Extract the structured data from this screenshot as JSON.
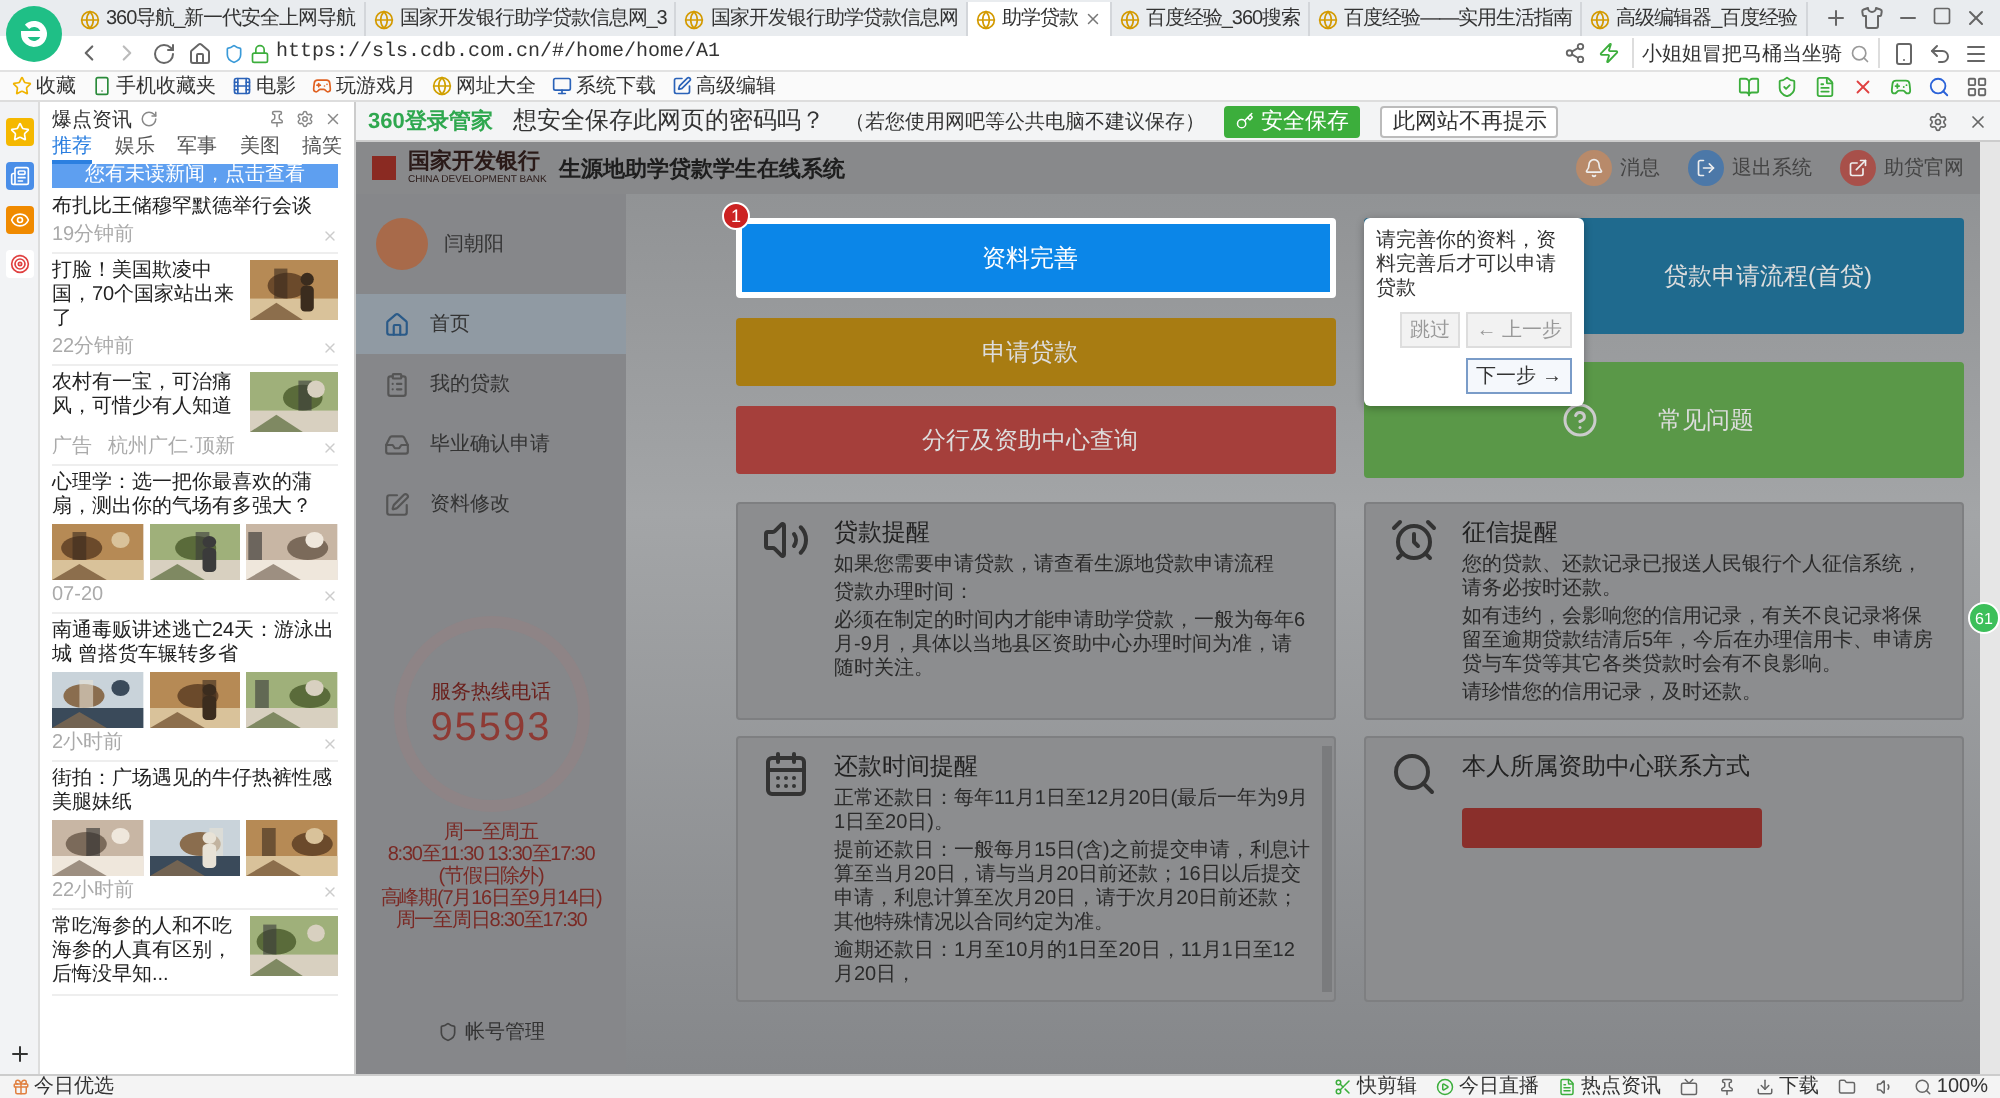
{
  "browser": {
    "tabs": [
      {
        "title": "360导航_新一代安全上网导航",
        "selected": false
      },
      {
        "title": "国家开发银行助学贷款信息网_3",
        "selected": false
      },
      {
        "title": "国家开发银行助学贷款信息网",
        "selected": false
      },
      {
        "title": "助学贷款",
        "selected": true
      },
      {
        "title": "百度经验_360搜索",
        "selected": false
      },
      {
        "title": "百度经验——实用生活指南",
        "selected": false
      },
      {
        "title": "高级编辑器_百度经验",
        "selected": false
      }
    ],
    "url": "https://sls.cdb.com.cn/#/home/home/A1",
    "search_value": "小姐姐冒把马桶当坐骑",
    "bookmarks": [
      "收藏",
      "手机收藏夹",
      "电影",
      "玩游戏月",
      "网址大全",
      "系统下载",
      "高级编辑"
    ]
  },
  "news_panel": {
    "title": "爆点资讯",
    "tabs": [
      {
        "label": "推荐",
        "selected": true
      },
      {
        "label": "娱乐",
        "selected": false
      },
      {
        "label": "军事",
        "selected": false
      },
      {
        "label": "美图",
        "selected": false
      },
      {
        "label": "搞笑",
        "selected": false
      }
    ],
    "banner": "您有未读新闻，点击查看",
    "items": [
      {
        "kind": "text",
        "title": "布扎比王储穆罕默德举行会谈",
        "meta": [
          "19分钟前"
        ]
      },
      {
        "kind": "right-image",
        "title": "打脸！美国欺凌中国，70个国家站出来了",
        "meta": [
          "22分钟前"
        ]
      },
      {
        "kind": "right-image",
        "title": "农村有一宝，可治痛风，可惜少有人知道",
        "meta": [
          "广告",
          "杭州广仁·顶新"
        ]
      },
      {
        "kind": "three-images",
        "title": "心理学：选一把你最喜欢的蒲扇，测出你的气场有多强大？",
        "meta": [
          "07-20"
        ]
      },
      {
        "kind": "three-images",
        "title": "南通毒贩讲述逃亡24天：游泳出城 曾搭货车辗转多省",
        "meta": [
          "2小时前"
        ]
      },
      {
        "kind": "three-images",
        "title": "街拍：广场遇见的牛仔热裤性感美腿妹纸",
        "meta": [
          "22小时前"
        ]
      },
      {
        "kind": "right-image",
        "title": "常吃海参的人和不吃海参的人真有区别，后悔没早知..."
      }
    ]
  },
  "password_prompt": {
    "brand": "360登录管家",
    "question": "想安全保存此网页的密码吗？",
    "note": "（若您使用网吧等公共电脑不建议保存）",
    "buttons": [
      {
        "label": "安全保存",
        "kind": "primary"
      },
      {
        "label": "此网站不再提示",
        "kind": "plain"
      }
    ]
  },
  "page": {
    "bank_name": "国家开发银行",
    "bank_name_en": "CHINA DEVELOPMENT BANK",
    "system_title": "生源地助学贷款学生在线系统",
    "header_links": [
      "消息",
      "退出系统",
      "助贷官网"
    ],
    "user_name": "闫朝阳",
    "nav": [
      {
        "label": "首页",
        "selected": true
      },
      {
        "label": "我的贷款",
        "selected": false
      },
      {
        "label": "毕业确认申请",
        "selected": false
      },
      {
        "label": "资料修改",
        "selected": false
      }
    ],
    "hotline": {
      "label": "服务热线电话",
      "number": "95593",
      "hours": [
        "周一至周五",
        "8:30至11:30 13:30至17:30",
        "(节假日除外)",
        "高峰期(7月16日至9月14日)",
        "周一至周日8:30至17:30"
      ]
    },
    "account_link": "帐号管理",
    "left_tiles": [
      {
        "label": "资料完善",
        "color": "#0b86e8",
        "highlighted": true
      },
      {
        "label": "申请贷款",
        "color": "#a87c12",
        "highlighted": false
      },
      {
        "label": "分行及资助中心查询",
        "color": "#a53f3b",
        "highlighted": false
      }
    ],
    "right_tiles": [
      {
        "label": "贷款申请流程(首贷)",
        "color": "#1f6a8e",
        "highlighted": false
      },
      {
        "label": "常见问题",
        "color": "#5a9848",
        "highlighted": false
      }
    ],
    "guide": {
      "step": "1",
      "text": "请完善你的资料，资料完善后才可以申请贷款",
      "skip": "跳过",
      "prev": "← 上一步",
      "next": "下一步 →"
    },
    "cards": [
      {
        "title": "贷款提醒",
        "lines": [
          "如果您需要申请贷款，请查看生源地贷款申请流程",
          "贷款办理时间：",
          "必须在制定的时间内才能申请助学贷款，一般为每年6月-9月，具体以当地县区资助中心办理时间为准，请随时关注。"
        ]
      },
      {
        "title": "征信提醒",
        "lines": [
          "您的贷款、还款记录已报送人民银行个人征信系统，请务必按时还款。",
          "如有违约，会影响您的信用记录，有关不良记录将保留至逾期贷款结清后5年，今后在办理信用卡、申请房贷与车贷等其它各类贷款时会有不良影响。",
          "请珍惜您的信用记录，及时还款。"
        ]
      },
      {
        "title": "还款时间提醒",
        "lines": [
          "正常还款日：每年11月1日至12月20日(最后一年为9月1日至20日)。",
          "提前还款日：一般每月15日(含)之前提交申请，利息计算至当月20日，请与当月20日前还款；16日以后提交申请，利息计算至次月20日，请于次月20日前还款；其他特殊情况以合同约定为准。",
          "逾期还款日：1月至10月的1日至20日，11月1日至12月20日，"
        ]
      },
      {
        "title": "本人所属资助中心联系方式"
      }
    ]
  },
  "scroll_badge": "61",
  "status_bar": {
    "left": "今日优选",
    "items": [
      "快剪辑",
      "今日直播",
      "热点资讯"
    ],
    "download": "下载",
    "zoom": "100%"
  }
}
